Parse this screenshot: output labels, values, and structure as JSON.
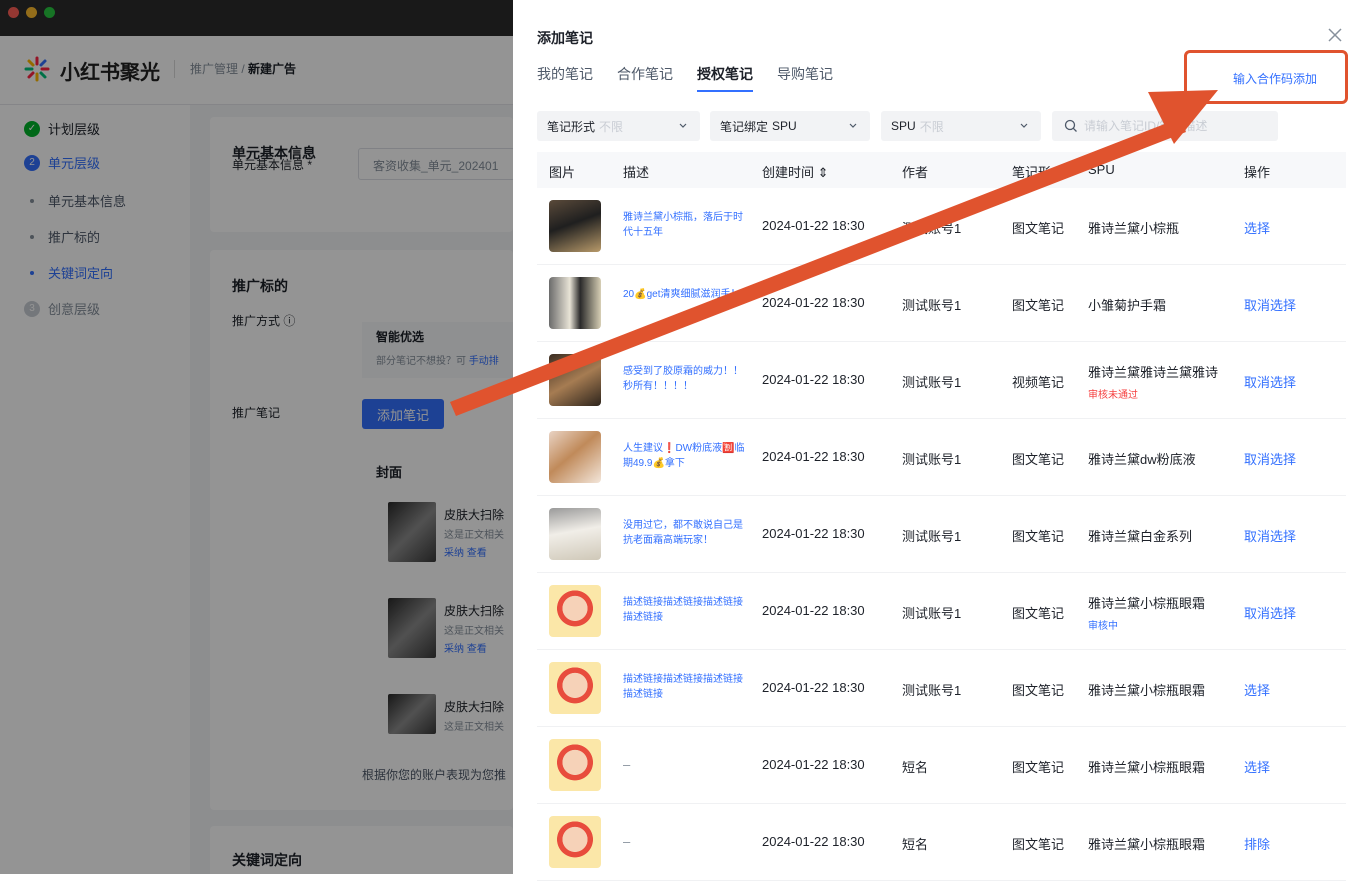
{
  "app": {
    "logo_text": "小红书聚光",
    "breadcrumb_parent": "推广管理 /",
    "breadcrumb_current": "新建广告"
  },
  "side_nav": [
    {
      "label": "计划层级",
      "state": "done"
    },
    {
      "label": "单元层级",
      "state": "active",
      "step": "2"
    },
    {
      "label": "单元基本信息",
      "state": "sub"
    },
    {
      "label": "推广标的",
      "state": "sub"
    },
    {
      "label": "关键词定向",
      "state": "sub-active"
    },
    {
      "label": "创意层级",
      "state": "todo",
      "step": "3"
    }
  ],
  "background_form": {
    "section1_title": "单元基本信息",
    "unit_name_label": "单元基本信息 *",
    "unit_name_value": "客资收集_单元_202401",
    "section2_title": "推广标的",
    "method_label": "推广方式 ⓘ",
    "smart_title": "智能优选",
    "smart_desc": "部分笔记不想投？可",
    "smart_link": "手动排",
    "notes_label": "推广笔记",
    "add_note_button": "添加笔记",
    "cover_label": "封面",
    "cards": [
      {
        "title": "皮肤大扫除",
        "sub": "这是正文相关",
        "actions": "采纳  查看"
      },
      {
        "title": "皮肤大扫除",
        "sub": "这是正文相关",
        "actions": "采纳  查看"
      },
      {
        "title": "皮肤大扫除",
        "sub": "这是正文相关",
        "actions": ""
      }
    ],
    "footer_hint": "根据你您的账户表现为您推",
    "section3_title": "关键词定向"
  },
  "drawer": {
    "title": "添加笔记",
    "tabs": [
      "我的笔记",
      "合作笔记",
      "授权笔记",
      "导购笔记"
    ],
    "active_tab": 2,
    "code_link": "输入合作码添加",
    "filters": {
      "form_label": "笔记形式",
      "form_value": "不限",
      "bind_label": "笔记绑定",
      "bind_value": "SPU",
      "spu_label": "SPU",
      "spu_value": "不限",
      "search_placeholder": "请输入笔记ID/笔记描述"
    },
    "columns": [
      "图片",
      "描述",
      "创建时间 ⇕",
      "作者",
      "笔记形式",
      "SPU",
      "操作"
    ],
    "rows": [
      {
        "desc": "雅诗兰黛小棕瓶，落后于时代十五年",
        "time": "2024-01-22 18:30",
        "author": "测试账号1",
        "type": "图文笔记",
        "spu": "雅诗兰黛小棕瓶",
        "status": "",
        "action": "选择",
        "thumb": "dark"
      },
      {
        "desc": "20💰get清爽细腻滋润手！",
        "time": "2024-01-22 18:30",
        "author": "测试账号1",
        "type": "图文笔记",
        "spu": "小雏菊护手霜",
        "status": "",
        "action": "取消选择",
        "thumb": "bottle"
      },
      {
        "desc": "感受到了胶原霜的威力！！秒所有！！！！",
        "time": "2024-01-22 18:30",
        "author": "测试账号1",
        "type": "视频笔记",
        "spu": "雅诗兰黛雅诗兰黛雅诗",
        "status": "审核未通过",
        "status_color": "#f53f3f",
        "action": "取消选择",
        "thumb": "jar"
      },
      {
        "desc": "人生建议❗DW粉底液🈹临期49.9💰拿下",
        "time": "2024-01-22 18:30",
        "author": "测试账号1",
        "type": "图文笔记",
        "spu": "雅诗兰黛dw粉底液",
        "status": "",
        "action": "取消选择",
        "thumb": "hand"
      },
      {
        "desc": "没用过它，都不敢说自己是抗老面霜高端玩家！",
        "time": "2024-01-22 18:30",
        "author": "测试账号1",
        "type": "图文笔记",
        "spu": "雅诗兰黛白金系列",
        "status": "",
        "action": "取消选择",
        "thumb": "cream"
      },
      {
        "desc": "描述链接描述链接描述链接描述链接",
        "time": "2024-01-22 18:30",
        "author": "测试账号1",
        "type": "图文笔记",
        "spu": "雅诗兰黛小棕瓶眼霜",
        "status": "审核中",
        "status_color": "#3370ff",
        "action": "取消选择",
        "thumb": "toy"
      },
      {
        "desc": "描述链接描述链接描述链接描述链接",
        "time": "2024-01-22 18:30",
        "author": "测试账号1",
        "type": "图文笔记",
        "spu": "雅诗兰黛小棕瓶眼霜",
        "status": "",
        "action": "选择",
        "thumb": "toy"
      },
      {
        "desc": "–",
        "time": "2024-01-22 18:30",
        "author": "短名",
        "type": "图文笔记",
        "spu": "雅诗兰黛小棕瓶眼霜",
        "status": "",
        "action": "选择",
        "thumb": "toy"
      },
      {
        "desc": "–",
        "time": "2024-01-22 18:30",
        "author": "短名",
        "type": "图文笔记",
        "spu": "雅诗兰黛小棕瓶眼霜",
        "status": "",
        "action": "排除",
        "thumb": "toy"
      }
    ]
  },
  "colors": {
    "primary": "#3370ff",
    "annotation": "#e0532e",
    "error": "#f53f3f"
  }
}
